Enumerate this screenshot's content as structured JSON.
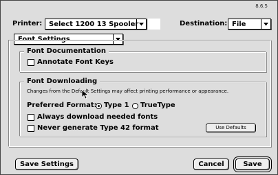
{
  "version": "8.6.5",
  "printer": {
    "label": "Printer:",
    "value": "Select 1200 13 Spooler"
  },
  "destination": {
    "label": "Destination:",
    "value": "File"
  },
  "panel_select": {
    "value": "Font Settings"
  },
  "font_documentation": {
    "title": "Font Documentation",
    "annotate_label": "Annotate Font Keys",
    "annotate_checked": false
  },
  "font_downloading": {
    "title": "Font Downloading",
    "note": "Changes from the Default Settings may affect printing performance or appearance.",
    "preferred_label": "Preferred Format:",
    "format_options": [
      {
        "label": "Type 1",
        "selected": true
      },
      {
        "label": "TrueType",
        "selected": false
      }
    ],
    "always_download_label": "Always download needed fonts",
    "always_download_checked": false,
    "never_type42_label": "Never generate Type 42 format",
    "never_type42_checked": false,
    "use_defaults_label": "Use Defaults"
  },
  "buttons": {
    "save_settings": "Save Settings",
    "cancel": "Cancel",
    "save": "Save"
  },
  "icons": [
    "chevron-down-icon",
    "mouse-cursor-icon"
  ]
}
